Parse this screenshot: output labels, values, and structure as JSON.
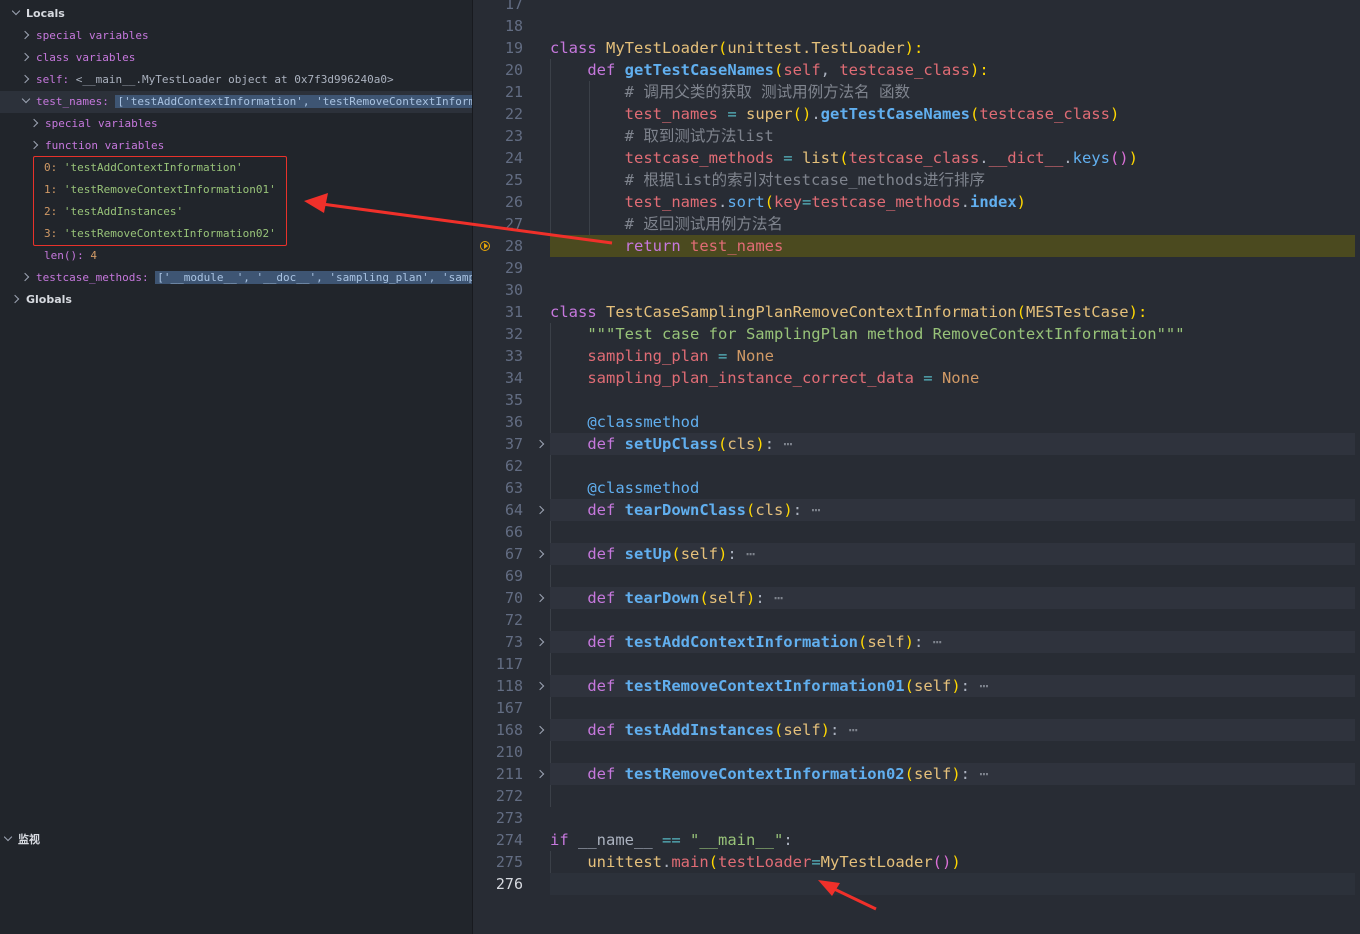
{
  "debug": {
    "locals_label": "Locals",
    "special_vars": "special variables",
    "class_vars": "class variables",
    "self_name": "self:",
    "self_value": "<__main__.MyTestLoader object at 0x7f3d996240a0>",
    "test_names_name": "test_names:",
    "test_names_value": "['testAddContextInformation', 'testRemoveContextInform…",
    "tn_special_vars": "special variables",
    "tn_function_vars": "function variables",
    "items": [
      {
        "idx": "0:",
        "val": "'testAddContextInformation'"
      },
      {
        "idx": "1:",
        "val": "'testRemoveContextInformation01'"
      },
      {
        "idx": "2:",
        "val": "'testAddInstances'"
      },
      {
        "idx": "3:",
        "val": "'testRemoveContextInformation02'"
      }
    ],
    "len_name": "len():",
    "len_value": "4",
    "tcm_name": "testcase_methods:",
    "tcm_value": "['__module__', '__doc__', 'sampling_plan', 'samp…",
    "globals_label": "Globals",
    "watch_label": "监视"
  },
  "gutter": [
    "17",
    "18",
    "19",
    "20",
    "21",
    "22",
    "23",
    "24",
    "25",
    "26",
    "27",
    "28",
    "29",
    "30",
    "31",
    "32",
    "33",
    "34",
    "35",
    "36",
    "37",
    "62",
    "63",
    "64",
    "66",
    "67",
    "69",
    "70",
    "72",
    "73",
    "117",
    "118",
    "167",
    "168",
    "210",
    "211",
    "272",
    "273",
    "274",
    "275",
    "276"
  ],
  "code": {
    "l19": {
      "kw": "class",
      "name": "MyTestLoader",
      "lp": "(",
      "base": "unittest.TestLoader",
      "rp": "):"
    },
    "l20": {
      "kw": "def",
      "name": "getTestCaseNames",
      "lp": "(",
      "a1": "self",
      "sep": ", ",
      "a2": "testcase_class",
      "rp": "):"
    },
    "l21": "# 调用父类的获取 测试用例方法名 函数",
    "l22": {
      "v": "test_names",
      "eq": " = ",
      "fn": "super",
      "p1": "()",
      "dot": ".",
      "m": "getTestCaseNames",
      "lp": "(",
      "a": "testcase_class",
      "rp": ")"
    },
    "l23": "# 取到测试方法list",
    "l24": {
      "v": "testcase_methods",
      "eq": " = ",
      "fn": "list",
      "lp": "(",
      "a": "testcase_class",
      "dot": ".",
      "attr": "__dict__",
      "dot2": ".",
      "m": "keys",
      "pp": "()",
      "rp": ")"
    },
    "l25": "# 根据list的索引对testcase_methods进行排序",
    "l26": {
      "v": "test_names",
      "dot": ".",
      "m": "sort",
      "lp": "(",
      "kwarg": "key",
      "eq": "=",
      "a": "testcase_methods",
      "dot2": ".",
      "attr": "index",
      "rp": ")"
    },
    "l27": "# 返回测试用例方法名",
    "l28": {
      "kw": "return",
      "v": "test_names"
    },
    "l31": {
      "kw": "class",
      "name": "TestCaseSamplingPlanRemoveContextInformation",
      "lp": "(",
      "base": "MESTestCase",
      "rp": "):"
    },
    "l32": "\"\"\"Test case for SamplingPlan method RemoveContextInformation\"\"\"",
    "l33": {
      "v": "sampling_plan",
      "eq": " = ",
      "val": "None"
    },
    "l34": {
      "v": "sampling_plan_instance_correct_data",
      "eq": " = ",
      "val": "None"
    },
    "deco": "@classmethod",
    "defs": [
      {
        "name": "setUpClass",
        "arg": "cls"
      },
      {
        "name": "tearDownClass",
        "arg": "cls"
      },
      {
        "name": "setUp",
        "arg": "self"
      },
      {
        "name": "tearDown",
        "arg": "self"
      },
      {
        "name": "testAddContextInformation",
        "arg": "self"
      },
      {
        "name": "testRemoveContextInformation01",
        "arg": "self"
      },
      {
        "name": "testAddInstances",
        "arg": "self"
      },
      {
        "name": "testRemoveContextInformation02",
        "arg": "self"
      }
    ],
    "def_kw": "def",
    "ellipsis": "⋯",
    "l274": {
      "kw": "if",
      "v": "__name__",
      "op": " == ",
      "s": "\"__main__\"",
      "colon": ":"
    },
    "l275": {
      "obj": "unittest",
      "dot": ".",
      "m": "main",
      "lp": "(",
      "kwarg": "testLoader",
      "eq": "=",
      "cls": "MyTestLoader",
      "pp": "()",
      "rp": ")"
    }
  },
  "colors": {
    "accent_red": "#f0302a",
    "current_line": "#4b4a1f",
    "breakpoint": "#e5a50a"
  }
}
